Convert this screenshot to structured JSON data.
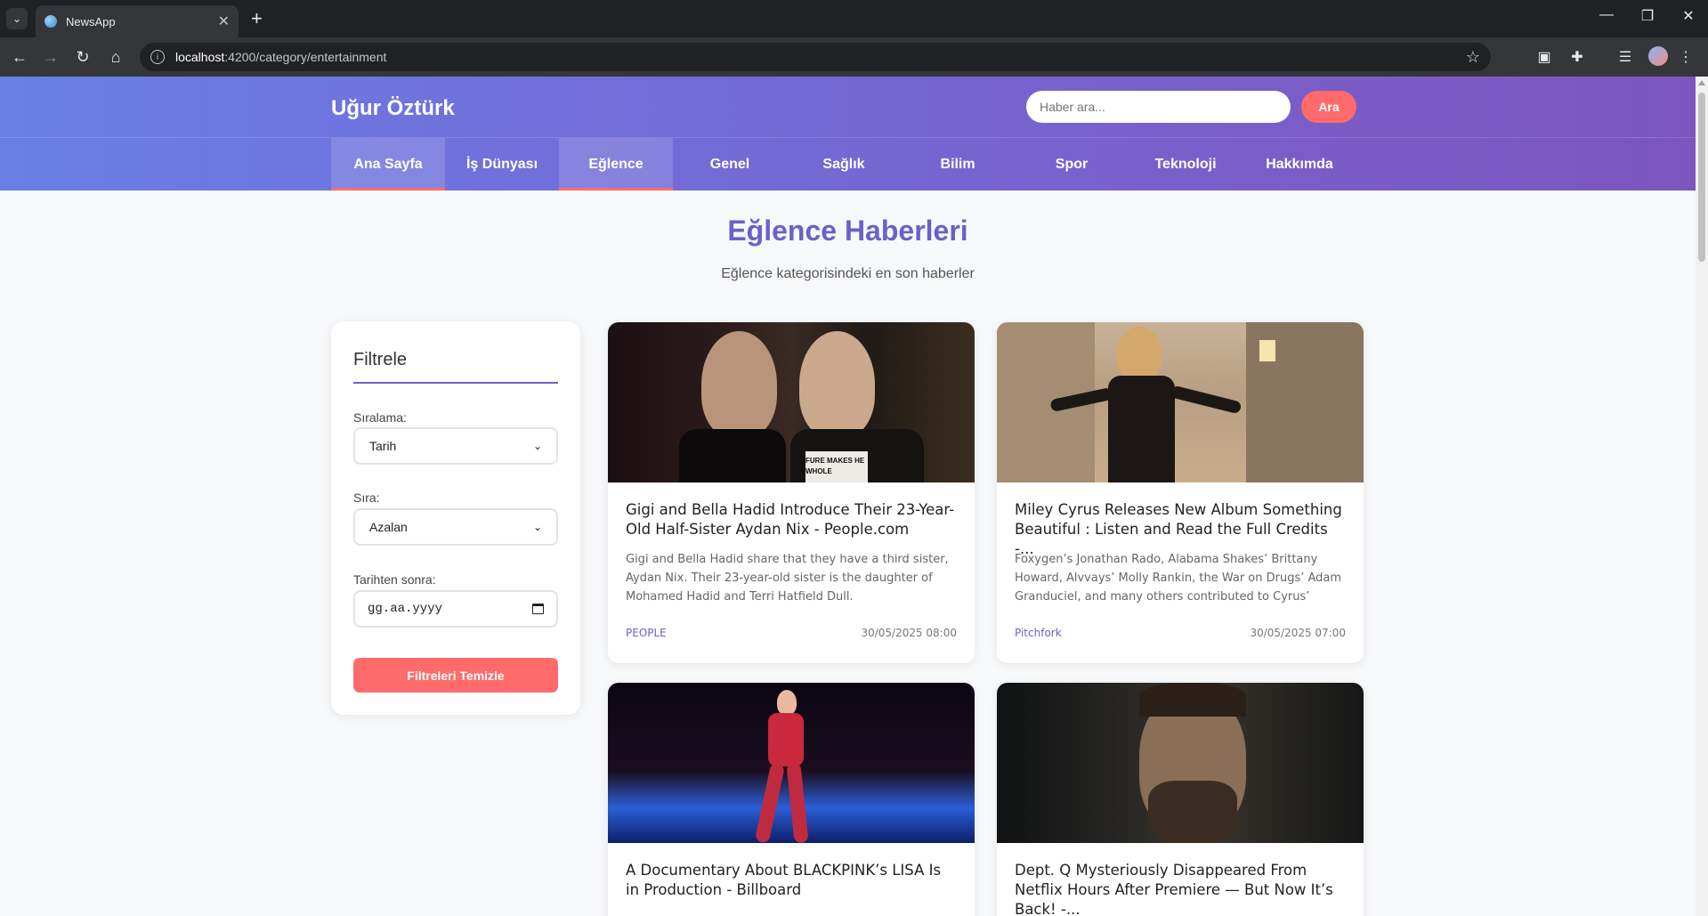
{
  "browser": {
    "tab_title": "NewsApp",
    "url_host": "localhost",
    "url_rest": ":4200/category/entertainment"
  },
  "site": {
    "brand": "Uğur Öztürk",
    "search_placeholder": "Haber ara...",
    "search_button": "Ara",
    "nav": [
      {
        "label": "Ana Sayfa",
        "active": true
      },
      {
        "label": "İş Dünyası",
        "active": false
      },
      {
        "label": "Eğlence",
        "active": true
      },
      {
        "label": "Genel",
        "active": false
      },
      {
        "label": "Sağlık",
        "active": false
      },
      {
        "label": "Bilim",
        "active": false
      },
      {
        "label": "Spor",
        "active": false
      },
      {
        "label": "Teknoloji",
        "active": false
      },
      {
        "label": "Hakkımda",
        "active": false
      }
    ]
  },
  "page": {
    "title": "Eğlence Haberleri",
    "subtitle": "Eğlence kategorisindeki en son haberler"
  },
  "filters": {
    "title": "Filtrele",
    "sort_label": "Sıralama:",
    "sort_value": "Tarih",
    "order_label": "Sıra:",
    "order_value": "Azalan",
    "date_label": "Tarihten sonra:",
    "date_placeholder": "gg.aa.yyyy",
    "clear_button": "Filtreleri Temizle"
  },
  "articles": [
    {
      "title": "Gigi and Bella Hadid Introduce Their 23-Year-Old Half-Sister Aydan Nix - People.com",
      "description": "Gigi and Bella Hadid share that they have a third sister, Aydan Nix. Their 23-year-old sister is the daughter of Mohamed Hadid and Terri Hatfield Dull.",
      "source": "PEOPLE",
      "date": "30/05/2025 08:00",
      "image_overlay_text": "FURE MAKES HE WHOLE"
    },
    {
      "title": "Miley Cyrus Releases New Album Something Beautiful : Listen and Read the Full Credits -...",
      "description": "Foxygen’s Jonathan Rado, Alabama Shakes’ Brittany Howard, Alvvays’ Molly Rankin, the War on Drugs’ Adam Granduciel, and many others contributed to Cyrus’ new...",
      "source": "Pitchfork",
      "date": "30/05/2025 07:00",
      "image_overlay_text": ""
    },
    {
      "title": "A Documentary About BLACKPINK’s LISA Is in Production - Billboard",
      "description": "",
      "source": "",
      "date": "",
      "image_overlay_text": ""
    },
    {
      "title": "Dept. Q Mysteriously Disappeared From Netflix Hours After Premiere — But Now It’s Back! -...",
      "description": "",
      "source": "",
      "date": "",
      "image_overlay_text": ""
    }
  ],
  "colors": {
    "accent": "#6e5fc9",
    "button": "#ff6b6b",
    "header_start": "#6a7ee6",
    "header_end": "#7d55bf"
  }
}
